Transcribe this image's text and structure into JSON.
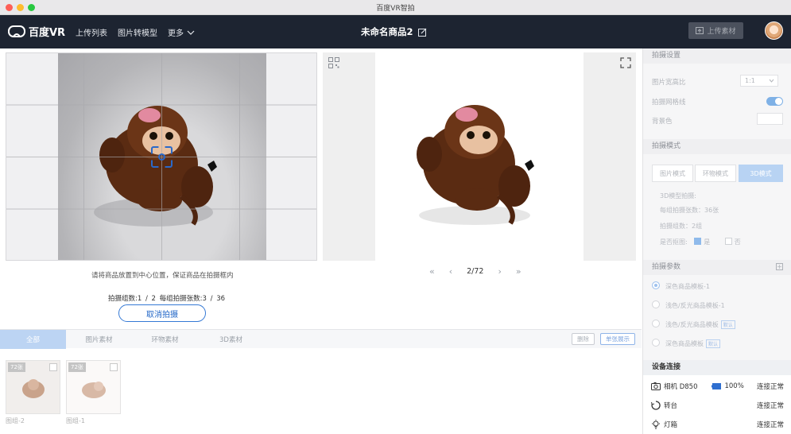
{
  "window": {
    "title": "百度VR智拍"
  },
  "header": {
    "logo": "百度VR",
    "nav": [
      "上传列表",
      "图片转模型",
      "更多"
    ],
    "project_title": "未命名商品2",
    "upload_button": "上传素材"
  },
  "capture": {
    "hint": "请将商品放置到中心位置，保证商品在拍摄框内",
    "group_count": "拍摄组数:1 / 2",
    "per_group": "每组拍摄张数:3 / 36",
    "cancel_button": "取消拍摄"
  },
  "preview": {
    "page": "2/72"
  },
  "asset_tabs": {
    "tabs": [
      "全部",
      "图片素材",
      "环物素材",
      "3D素材"
    ],
    "active": "全部",
    "delete_button": "删除",
    "single_show_button": "单张展示"
  },
  "thumbnails": [
    {
      "label": "图组-2",
      "badge": "72张"
    },
    {
      "label": "图组-1",
      "badge": "72张"
    }
  ],
  "right_panel": {
    "shooting_settings": {
      "title": "拍摄设置",
      "ratio_label": "图片宽高比",
      "ratio_value": "1:1",
      "grid_label": "拍摄网格线",
      "grid_on": true,
      "bg_label": "背景色"
    },
    "shooting_mode": {
      "title": "拍摄模式",
      "modes": [
        "图片模式",
        "环物模式",
        "3D模式"
      ],
      "active": "3D模式",
      "info_title": "3D模型拍摄:",
      "info_per_group": "每组拍摄张数：36张",
      "info_groups": "拍摄组数：2组",
      "cutout_label": "是否抠图:",
      "yes": "是",
      "no": "否",
      "cutout_selected": "是"
    },
    "shooting_params": {
      "title": "拍摄参数",
      "templates": [
        {
          "label": "深色商品模板-1",
          "selected": true,
          "tag": ""
        },
        {
          "label": "浅色/反光商品模板-1",
          "selected": false,
          "tag": ""
        },
        {
          "label": "浅色/反光商品模板",
          "selected": false,
          "tag": "默认"
        },
        {
          "label": "深色商品模板",
          "selected": false,
          "tag": "默认"
        }
      ]
    },
    "device": {
      "title": "设备连接",
      "rows": [
        {
          "name": "相机 D850",
          "battery": "100%",
          "status": "连接正常",
          "icon": "camera-icon"
        },
        {
          "name": "转台",
          "battery": "",
          "status": "连接正常",
          "icon": "turntable-icon"
        },
        {
          "name": "灯箱",
          "battery": "",
          "status": "连接正常",
          "icon": "lightbox-icon"
        }
      ]
    }
  },
  "colors": {
    "header_bg": "#1d2431",
    "accent": "#2a69c9",
    "toggle": "#7fb1e6"
  }
}
